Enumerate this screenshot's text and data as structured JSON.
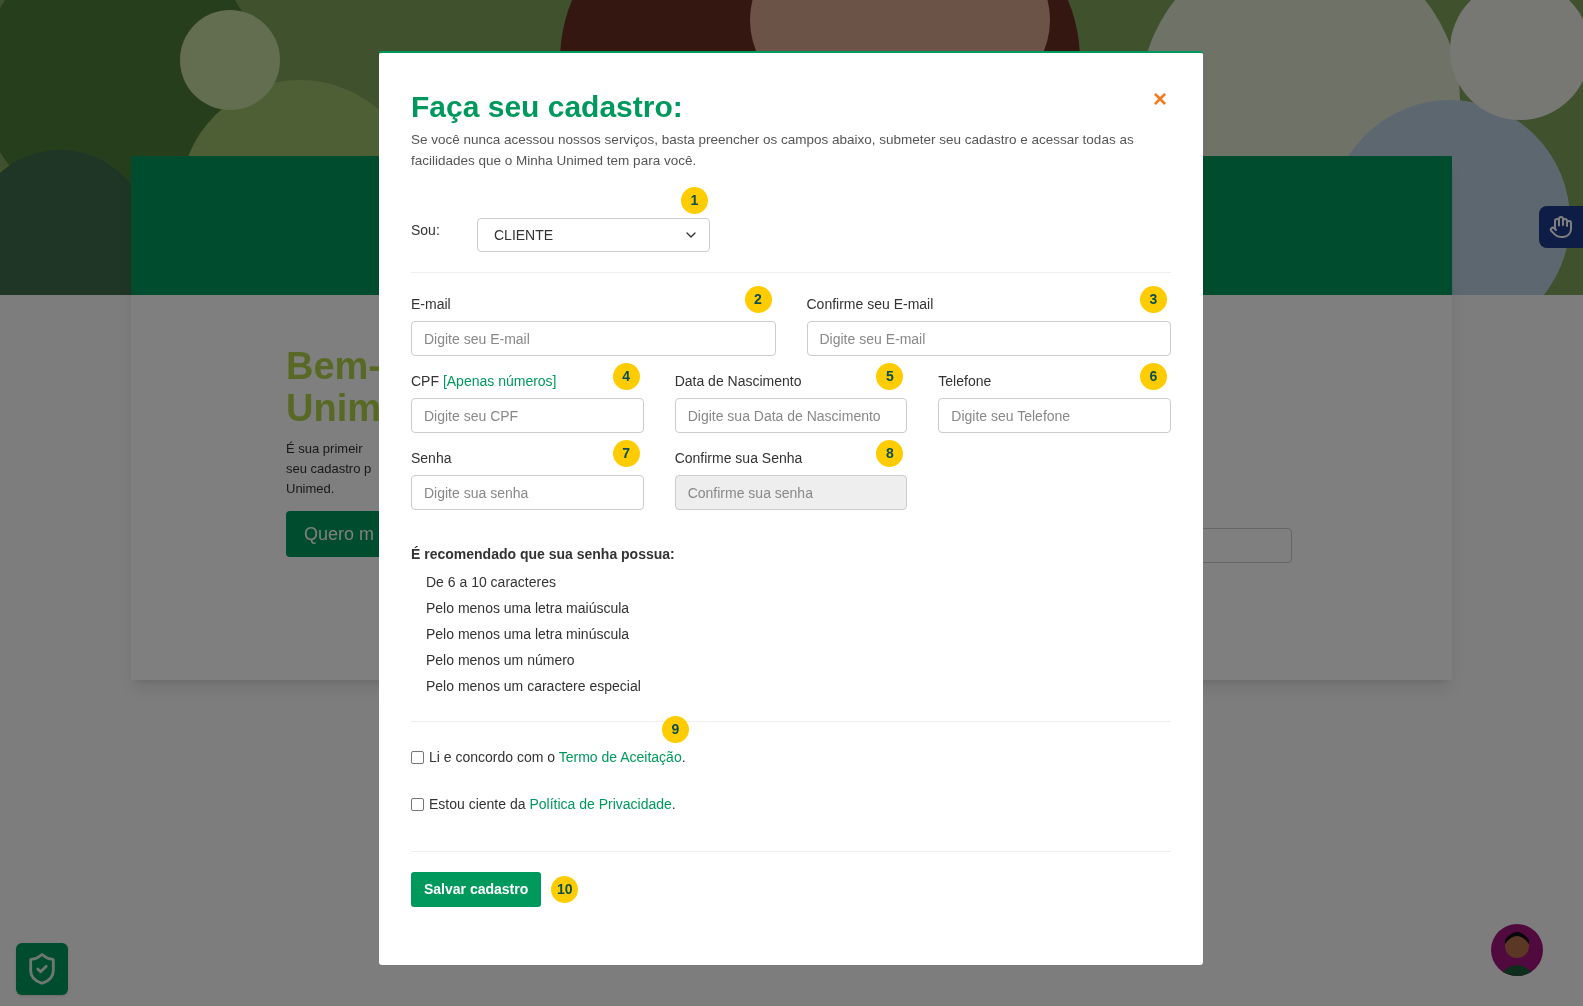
{
  "background": {
    "heading_lines": [
      "Bem-",
      "Unim"
    ],
    "text_lines": [
      "É sua primeir",
      "seu cadastro p",
      "Unimed."
    ],
    "button": "Quero m"
  },
  "modal": {
    "title": "Faça seu cadastro:",
    "close": "×",
    "description": "Se você nunca acessou nossos serviços, basta preencher os campos abaixo, submeter seu cadastro e acessar todas as facilidades que o Minha Unimed tem para você.",
    "role": {
      "label": "Sou:",
      "value": "CLIENTE",
      "badge": "1"
    },
    "field_rows": [
      [
        {
          "label": "E-mail",
          "placeholder": "Digite seu E-mail",
          "badge": "2",
          "disabled": false
        },
        {
          "label": "Confirme seu E-mail",
          "placeholder": "Digite seu E-mail",
          "badge": "3",
          "disabled": false
        }
      ],
      [
        {
          "label": "CPF",
          "hint": "[Apenas números]",
          "placeholder": "Digite seu CPF",
          "badge": "4",
          "disabled": false
        },
        {
          "label": "Data de Nascimento",
          "placeholder": "Digite sua Data de Nascimento",
          "badge": "5",
          "disabled": false
        },
        {
          "label": "Telefone",
          "placeholder": "Digite seu Telefone",
          "badge": "6",
          "disabled": false
        }
      ],
      [
        {
          "label": "Senha",
          "placeholder": "Digite sua senha",
          "badge": "7",
          "disabled": false
        },
        {
          "label": "Confirme sua Senha",
          "placeholder": "Confirme sua senha",
          "badge": "8",
          "disabled": true
        }
      ]
    ],
    "password_tips": {
      "title": "É recomendado que sua senha possua:",
      "items": [
        "De 6 a 10 caracteres",
        "Pelo menos uma letra maiúscula",
        "Pelo menos uma letra minúscula",
        "Pelo menos um número",
        "Pelo menos um caractere especial"
      ]
    },
    "agreements_badge": "9",
    "agreements": [
      {
        "text": "Li e concordo com o",
        "link": "Termo de Aceitação",
        "end": ".",
        "checked": false
      },
      {
        "text": "Estou ciente da",
        "link": "Política de Privacidade",
        "end": ".",
        "checked": false
      }
    ],
    "save_button": {
      "label": "Salvar cadastro",
      "badge": "10"
    }
  }
}
